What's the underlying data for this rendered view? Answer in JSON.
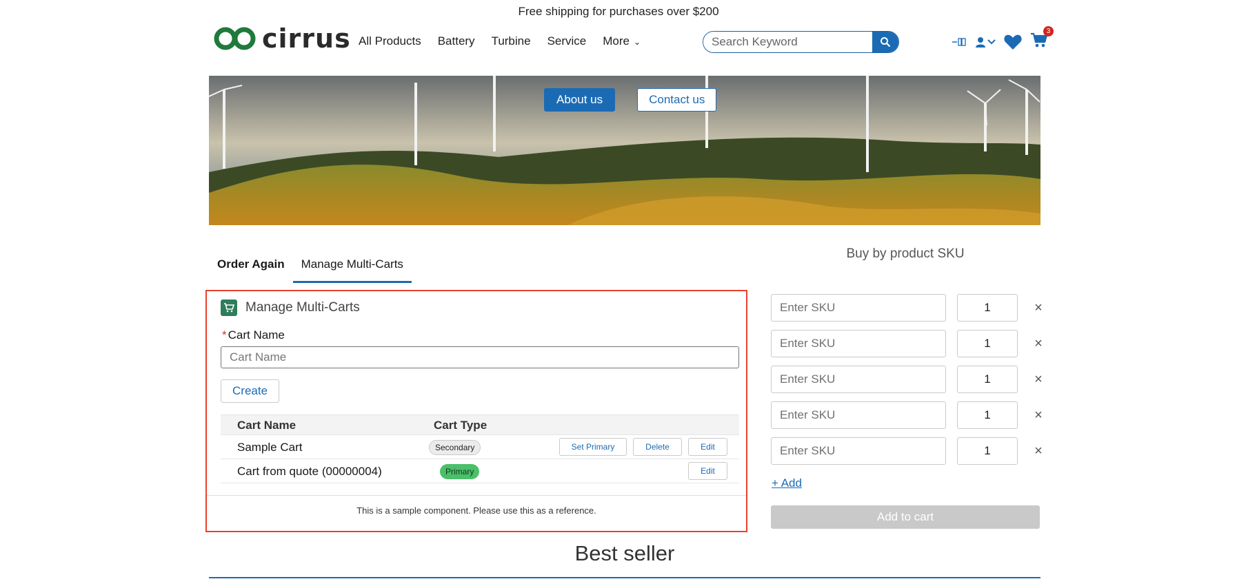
{
  "promo": {
    "text": "Free shipping for purchases over $200"
  },
  "logo": {
    "text": "cirrus"
  },
  "nav": {
    "items": [
      "All Products",
      "Battery",
      "Turbine",
      "Service",
      "More"
    ]
  },
  "search": {
    "placeholder": "Search Keyword"
  },
  "header_icons": {
    "cart_count": "3"
  },
  "hero": {
    "about_label": "About us",
    "contact_label": "Contact us"
  },
  "tabs": [
    {
      "label": "Order Again",
      "active": false
    },
    {
      "label": "Manage Multi-Carts",
      "active": true
    }
  ],
  "multi_carts": {
    "title": "Manage Multi-Carts",
    "required_marker": "*",
    "cart_name_label": "Cart Name",
    "cart_name_placeholder": "Cart Name",
    "create_label": "Create",
    "columns": [
      "Cart Name",
      "Cart Type"
    ],
    "rows": [
      {
        "name": "Sample Cart",
        "type": "Secondary",
        "actions": [
          "Set Primary",
          "Delete",
          "Edit"
        ]
      },
      {
        "name": "Cart from quote (00000004)",
        "type": "Primary",
        "actions": [
          "Edit"
        ]
      }
    ],
    "footer": "This is a sample component. Please use this as a reference."
  },
  "sku": {
    "title": "Buy by product SKU",
    "placeholder": "Enter SKU",
    "rows": [
      {
        "qty": "1"
      },
      {
        "qty": "1"
      },
      {
        "qty": "1"
      },
      {
        "qty": "1"
      },
      {
        "qty": "1"
      }
    ],
    "add_label": "+ Add",
    "add_to_cart_label": "Add to cart"
  },
  "best_seller": {
    "title": "Best seller"
  },
  "colors": {
    "brand": "#1b6bb4",
    "highlight": "#e8412c",
    "primary_pill": "#4bbf6a"
  }
}
